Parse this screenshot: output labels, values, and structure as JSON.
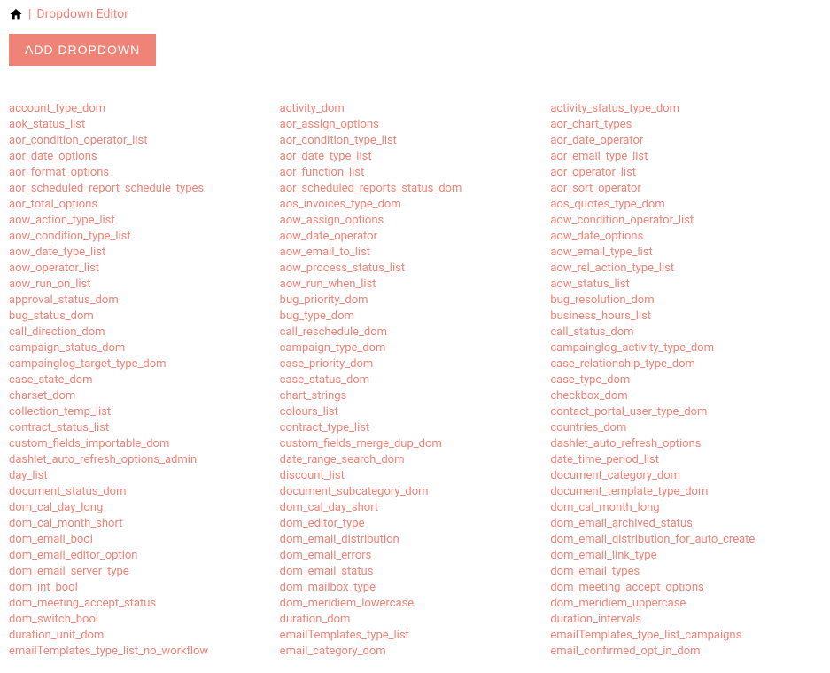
{
  "breadcrumb": {
    "separator": "|",
    "current": "Dropdown Editor"
  },
  "buttons": {
    "add_dropdown": "ADD DROPDOWN"
  },
  "columns": [
    [
      "account_type_dom",
      "aok_status_list",
      "aor_condition_operator_list",
      "aor_date_options",
      "aor_format_options",
      "aor_scheduled_report_schedule_types",
      "aor_total_options",
      "aow_action_type_list",
      "aow_condition_type_list",
      "aow_date_type_list",
      "aow_operator_list",
      "aow_run_on_list",
      "approval_status_dom",
      "bug_status_dom",
      "call_direction_dom",
      "campaign_status_dom",
      "campainglog_target_type_dom",
      "case_state_dom",
      "charset_dom",
      "collection_temp_list",
      "contract_status_list",
      "custom_fields_importable_dom",
      "dashlet_auto_refresh_options_admin",
      "day_list",
      "document_status_dom",
      "dom_cal_day_long",
      "dom_cal_month_short",
      "dom_email_bool",
      "dom_email_editor_option",
      "dom_email_server_type",
      "dom_int_bool",
      "dom_meeting_accept_status",
      "dom_switch_bool",
      "duration_unit_dom",
      "emailTemplates_type_list_no_workflow"
    ],
    [
      "activity_dom",
      "aor_assign_options",
      "aor_condition_type_list",
      "aor_date_type_list",
      "aor_function_list",
      "aor_scheduled_reports_status_dom",
      "aos_invoices_type_dom",
      "aow_assign_options",
      "aow_date_operator",
      "aow_email_to_list",
      "aow_process_status_list",
      "aow_run_when_list",
      "bug_priority_dom",
      "bug_type_dom",
      "call_reschedule_dom",
      "campaign_type_dom",
      "case_priority_dom",
      "case_status_dom",
      "chart_strings",
      "colours_list",
      "contract_type_list",
      "custom_fields_merge_dup_dom",
      "date_range_search_dom",
      "discount_list",
      "document_subcategory_dom",
      "dom_cal_day_short",
      "dom_editor_type",
      "dom_email_distribution",
      "dom_email_errors",
      "dom_email_status",
      "dom_mailbox_type",
      "dom_meridiem_lowercase",
      "duration_dom",
      "emailTemplates_type_list",
      "email_category_dom"
    ],
    [
      "activity_status_type_dom",
      "aor_chart_types",
      "aor_date_operator",
      "aor_email_type_list",
      "aor_operator_list",
      "aor_sort_operator",
      "aos_quotes_type_dom",
      "aow_condition_operator_list",
      "aow_date_options",
      "aow_email_type_list",
      "aow_rel_action_type_list",
      "aow_status_list",
      "bug_resolution_dom",
      "business_hours_list",
      "call_status_dom",
      "campainglog_activity_type_dom",
      "case_relationship_type_dom",
      "case_type_dom",
      "checkbox_dom",
      "contact_portal_user_type_dom",
      "countries_dom",
      "dashlet_auto_refresh_options",
      "date_time_period_list",
      "document_category_dom",
      "document_template_type_dom",
      "dom_cal_month_long",
      "dom_email_archived_status",
      "dom_email_distribution_for_auto_create",
      "dom_email_link_type",
      "dom_email_types",
      "dom_meeting_accept_options",
      "dom_meridiem_uppercase",
      "duration_intervals",
      "emailTemplates_type_list_campaigns",
      "email_confirmed_opt_in_dom"
    ]
  ]
}
